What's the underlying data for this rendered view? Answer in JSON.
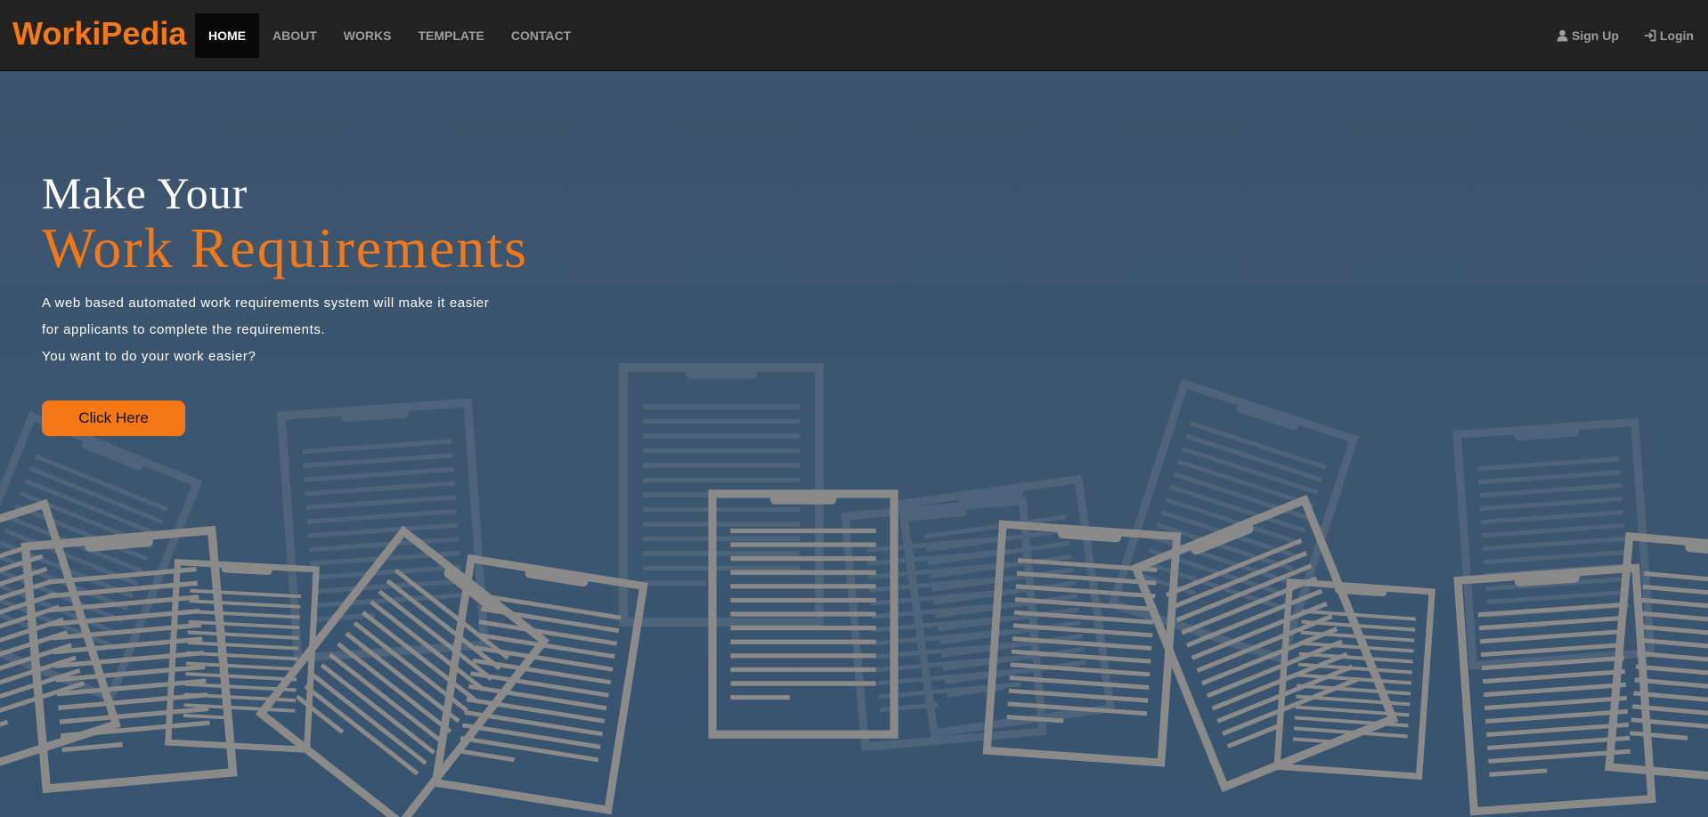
{
  "brand": "WorkiPedia",
  "nav": {
    "items": [
      "HOME",
      "ABOUT",
      "WORKS",
      "TEMPLATE",
      "CONTACT"
    ],
    "active": "HOME",
    "sign_up": "Sign Up",
    "login": "Login"
  },
  "hero": {
    "headline_line1": "Make Your",
    "headline_line2": "Work Requirements",
    "description": [
      "A web based automated work requirements system will make it easier",
      "for applicants to complete the requirements.",
      "You want to do your work easier?"
    ],
    "button_label": "Click Here"
  },
  "colors": {
    "accent": "#f57816",
    "navbar": "#222222",
    "hero_background": "#3c5670",
    "active_tab": "#080808"
  },
  "icons": [
    "user-icon",
    "login-icon",
    "document-icon"
  ]
}
